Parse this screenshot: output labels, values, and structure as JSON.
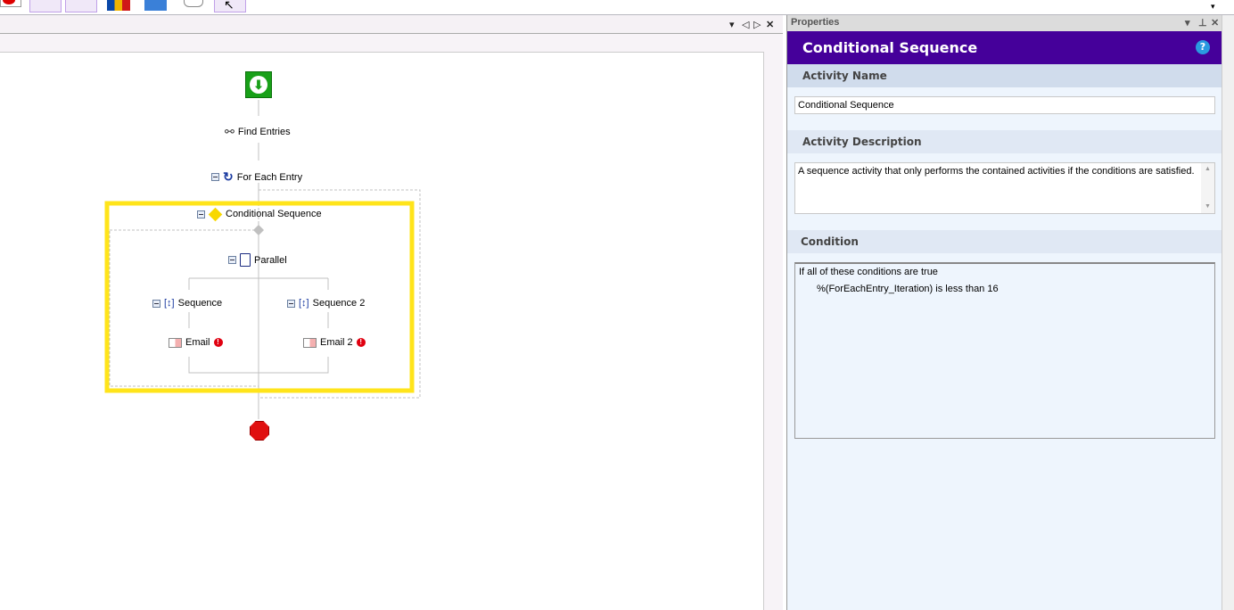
{
  "toolbar": {
    "overflow_icon": "chevron-down-icon"
  },
  "designer": {
    "nodes": {
      "start": "start-icon",
      "find_entries": "Find Entries",
      "for_each_entry": "For Each Entry",
      "conditional_sequence": "Conditional Sequence",
      "parallel": "Parallel",
      "sequence": "Sequence",
      "sequence2": "Sequence 2",
      "email": "Email",
      "email2": "Email 2"
    },
    "error_glyph": "!"
  },
  "properties": {
    "title": "Properties",
    "header": "Conditional Sequence",
    "help_glyph": "?",
    "activity_name_label": "Activity Name",
    "activity_name_value": "Conditional Sequence",
    "activity_description_label": "Activity Description",
    "activity_description_value": "A sequence activity that only performs the contained activities if the conditions are satisfied.",
    "condition_label": "Condition",
    "condition_intro": "If all of these conditions are true",
    "condition_rule": "%(ForEachEntry_Iteration) is less than 16"
  },
  "colors": {
    "accent": "#45009a",
    "selection": "#ffe41a",
    "section": "#d0dcec",
    "panel": "#eef5fd"
  }
}
